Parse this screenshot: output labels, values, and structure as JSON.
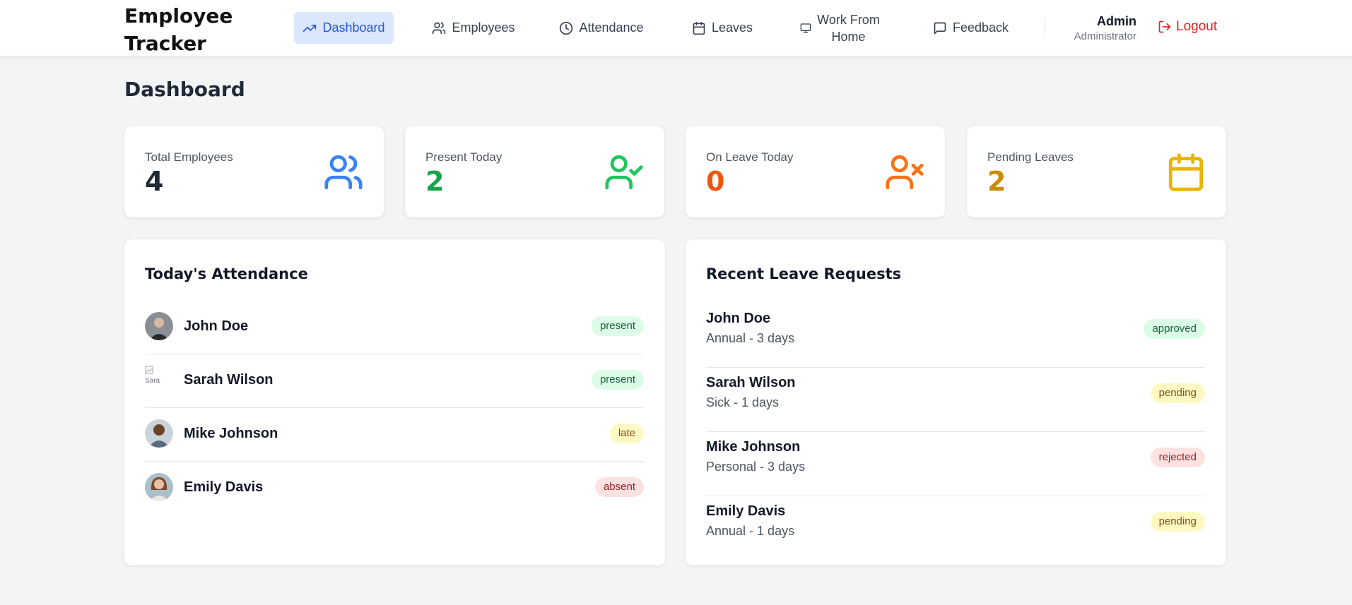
{
  "app": {
    "title": "Employee Tracker"
  },
  "nav": {
    "items": [
      {
        "label": "Dashboard",
        "icon": "trending-up-icon",
        "active": true
      },
      {
        "label": "Employees",
        "icon": "users-icon"
      },
      {
        "label": "Attendance",
        "icon": "clock-icon"
      },
      {
        "label": "Leaves",
        "icon": "calendar-icon"
      },
      {
        "label_line1": "Work From",
        "label_line2": "Home",
        "icon": "monitor-icon"
      },
      {
        "label": "Feedback",
        "icon": "message-square-icon"
      }
    ]
  },
  "user": {
    "name": "Admin",
    "role": "Administrator",
    "logout_label": "Logout"
  },
  "page": {
    "title": "Dashboard"
  },
  "stats": [
    {
      "label": "Total Employees",
      "value": "4",
      "color": "#1f2937",
      "icon": "users-icon",
      "icon_color": "#3b82f6"
    },
    {
      "label": "Present Today",
      "value": "2",
      "color": "#16a34a",
      "icon": "user-check-icon",
      "icon_color": "#22c55e"
    },
    {
      "label": "On Leave Today",
      "value": "0",
      "color": "#ea580c",
      "icon": "user-x-icon",
      "icon_color": "#f97316"
    },
    {
      "label": "Pending Leaves",
      "value": "2",
      "color": "#ca8a04",
      "icon": "calendar-icon",
      "icon_color": "#eab308"
    }
  ],
  "attendance": {
    "title": "Today's Attendance",
    "rows": [
      {
        "name": "John Doe",
        "status": "present"
      },
      {
        "name": "Sarah Wilson",
        "status": "present",
        "avatar_alt": "Sara"
      },
      {
        "name": "Mike Johnson",
        "status": "late"
      },
      {
        "name": "Emily Davis",
        "status": "absent"
      }
    ]
  },
  "leaves": {
    "title": "Recent Leave Requests",
    "rows": [
      {
        "name": "John Doe",
        "detail": "Annual - 3 days",
        "status": "approved"
      },
      {
        "name": "Sarah Wilson",
        "detail": "Sick - 1 days",
        "status": "pending"
      },
      {
        "name": "Mike Johnson",
        "detail": "Personal - 3 days",
        "status": "rejected"
      },
      {
        "name": "Emily Davis",
        "detail": "Annual - 1 days",
        "status": "pending"
      }
    ]
  },
  "colors": {
    "accent": "#2557d6",
    "active_nav_bg": "#dbe7fd",
    "logout": "#dc2626"
  }
}
